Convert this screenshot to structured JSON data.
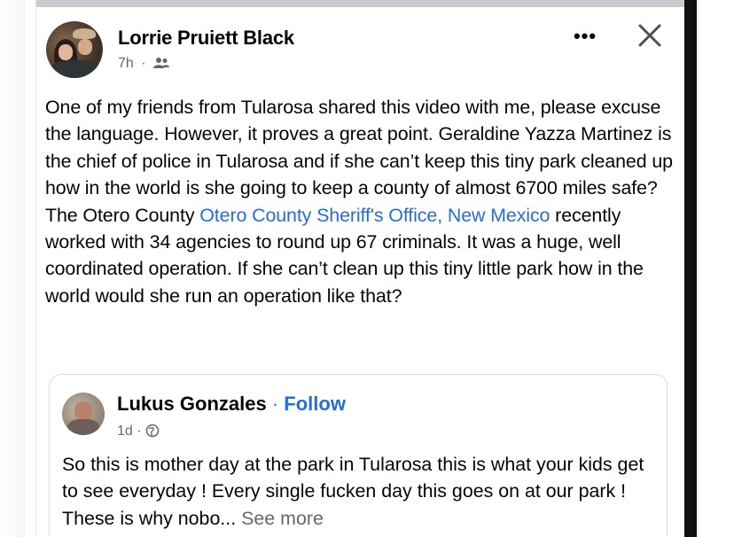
{
  "post": {
    "author": "Lorrie Pruiett Black",
    "time": "7h",
    "meta_separator": "·",
    "audience_icon": "friends-icon",
    "more_label": "•••",
    "close_icon": "close-icon",
    "text_part1": "One of my friends from Tularosa shared this video with me, please excuse the language. However, it proves a great point. Geraldine Yazza Martinez is the chief of police in Tularosa and if she can’t keep this tiny park cleaned up how in the world is she going to keep a county of almost 6700 miles safe? The Otero County ",
    "tag_link": "Otero County Sheriff's Office, New Mexico",
    "text_part2": " recently worked with 34 agencies to round up 67 criminals. It was a huge, well coordinated operation. If she can’t clean up this tiny little park how in the world would she run an operation like that?"
  },
  "shared_post": {
    "author": "Lukus Gonzales",
    "name_separator": " · ",
    "follow_label": "Follow",
    "time": "1d",
    "meta_separator": "·",
    "audience_icon": "globe-icon",
    "text": "So this is mother day at the park in Tularosa this is what your kids get to see everyday !  Every single fucken day this goes on at our park ! These is why nobo... ",
    "see_more_label": "See more"
  },
  "colors": {
    "link": "#216fdb",
    "text": "#050505",
    "secondary": "#65676b"
  }
}
